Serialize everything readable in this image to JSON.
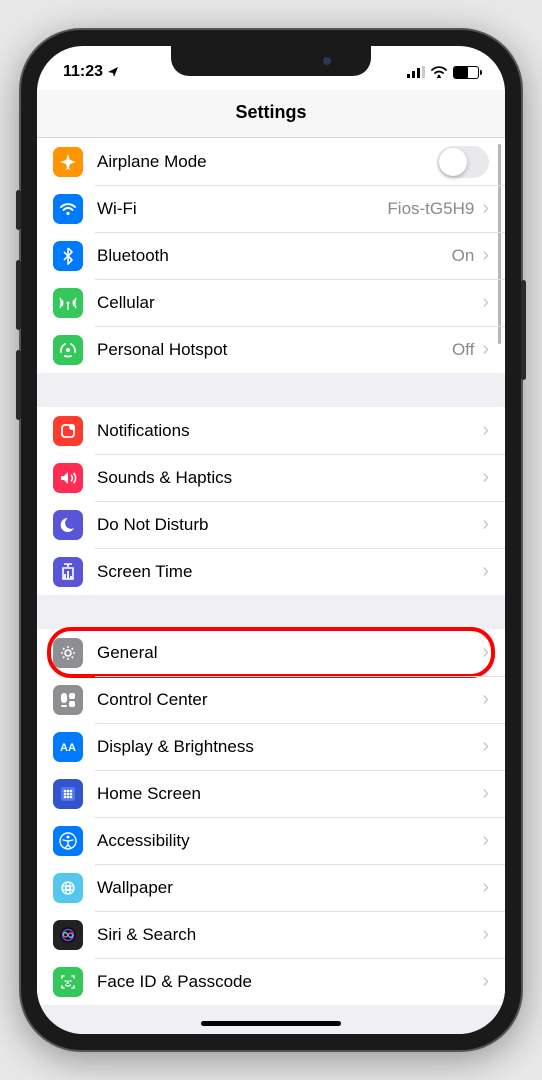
{
  "status": {
    "time": "11:23"
  },
  "title": "Settings",
  "groups": [
    {
      "rows": [
        {
          "key": "airplane",
          "label": "Airplane Mode",
          "type": "toggle",
          "icon": "airplane",
          "color": "#ff9500"
        },
        {
          "key": "wifi",
          "label": "Wi-Fi",
          "value": "Fios-tG5H9",
          "type": "link",
          "icon": "wifi",
          "color": "#007aff"
        },
        {
          "key": "bluetooth",
          "label": "Bluetooth",
          "value": "On",
          "type": "link",
          "icon": "bluetooth",
          "color": "#007aff"
        },
        {
          "key": "cellular",
          "label": "Cellular",
          "type": "link",
          "icon": "cellular",
          "color": "#34c759"
        },
        {
          "key": "hotspot",
          "label": "Personal Hotspot",
          "value": "Off",
          "type": "link",
          "icon": "hotspot",
          "color": "#34c759"
        }
      ]
    },
    {
      "rows": [
        {
          "key": "notifications",
          "label": "Notifications",
          "type": "link",
          "icon": "notifications",
          "color": "#ff3b30"
        },
        {
          "key": "sounds",
          "label": "Sounds & Haptics",
          "type": "link",
          "icon": "sounds",
          "color": "#ff2d55"
        },
        {
          "key": "dnd",
          "label": "Do Not Disturb",
          "type": "link",
          "icon": "dnd",
          "color": "#5856d6"
        },
        {
          "key": "screentime",
          "label": "Screen Time",
          "type": "link",
          "icon": "screentime",
          "color": "#5856d6"
        }
      ]
    },
    {
      "rows": [
        {
          "key": "general",
          "label": "General",
          "type": "link",
          "icon": "general",
          "color": "#8e8e93",
          "highlight": true
        },
        {
          "key": "controlcenter",
          "label": "Control Center",
          "type": "link",
          "icon": "controlcenter",
          "color": "#8e8e93"
        },
        {
          "key": "display",
          "label": "Display & Brightness",
          "type": "link",
          "icon": "display",
          "color": "#007aff"
        },
        {
          "key": "homescreen",
          "label": "Home Screen",
          "type": "link",
          "icon": "homescreen",
          "color": "#3355cc"
        },
        {
          "key": "accessibility",
          "label": "Accessibility",
          "type": "link",
          "icon": "accessibility",
          "color": "#007aff"
        },
        {
          "key": "wallpaper",
          "label": "Wallpaper",
          "type": "link",
          "icon": "wallpaper",
          "color": "#54c7ec"
        },
        {
          "key": "siri",
          "label": "Siri & Search",
          "type": "link",
          "icon": "siri",
          "color": "#222"
        },
        {
          "key": "faceid",
          "label": "Face ID & Passcode",
          "type": "link",
          "icon": "faceid",
          "color": "#34c759"
        }
      ]
    }
  ]
}
